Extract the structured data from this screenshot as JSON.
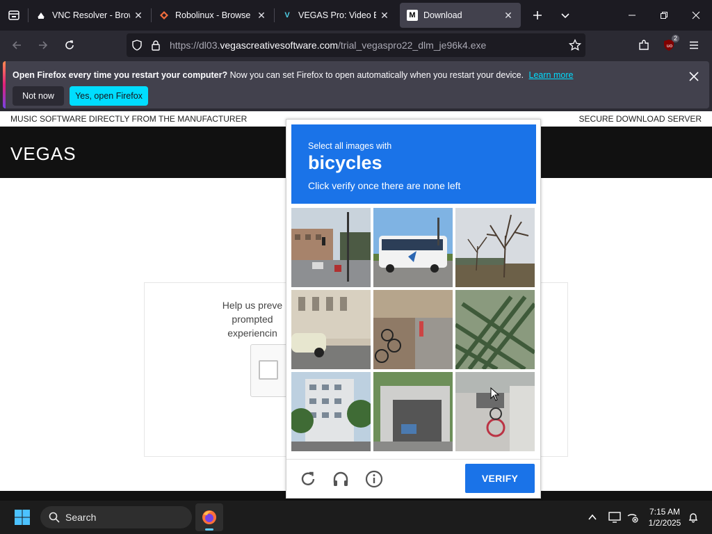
{
  "browser": {
    "tabs": [
      {
        "title": "VNC Resolver - Browse",
        "favicon": "vnc-icon"
      },
      {
        "title": "Robolinux - Browse File",
        "favicon": "robolinux-icon"
      },
      {
        "title": "VEGAS Pro: Video Editi",
        "favicon": "vegas-icon",
        "favicon_letter": "V"
      },
      {
        "title": "Download",
        "favicon": "m-icon",
        "favicon_letter": "M",
        "active": true
      }
    ],
    "url_prefix": "https://dl03.",
    "url_domain": "vegascreativesoftware.com",
    "url_path": "/trial_vegaspro22_dlm_je96k4.exe",
    "extension_badge": "2"
  },
  "notification": {
    "bold_text": "Open Firefox every time you restart your computer?",
    "text": "Now you can set Firefox to open automatically when you restart your device.",
    "link": "Learn more",
    "not_now": "Not now",
    "yes_open": "Yes, open Firefox"
  },
  "page": {
    "tagline_left": "MUSIC SOFTWARE DIRECTLY FROM THE MANUFACTURER",
    "tagline_right": "SECURE DOWNLOAD SERVER",
    "logo": "VEGAS",
    "verify_line1": "Help us preve",
    "verify_line2": "prompted",
    "verify_line3": "experiencin"
  },
  "captcha": {
    "instruction": "Select all images with",
    "target": "bicycles",
    "sub": "Click verify once there are none left",
    "verify_label": "VERIFY",
    "tiles": [
      "street intersection with traffic lights",
      "white coach bus",
      "bare tree behind a bridge",
      "white car passing a building",
      "sidewalk with parked bicycles",
      "green lattice structure",
      "apartment building with trees",
      "concrete garage entrance",
      "bicycle parked by a wall"
    ]
  },
  "taskbar": {
    "search_label": "Search",
    "time": "7:15 AM",
    "date": "1/2/2025"
  },
  "colors": {
    "accent_blue": "#1a73e8",
    "firefox_cyan": "#00ddff",
    "chrome_dark": "#1c1b22"
  }
}
